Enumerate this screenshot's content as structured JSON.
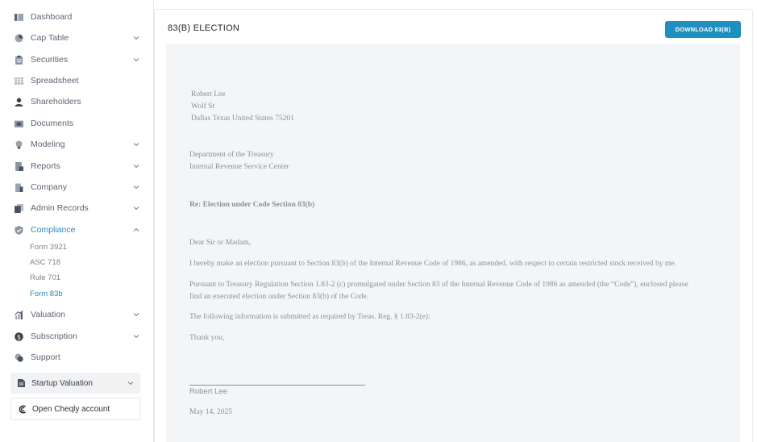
{
  "sidebar": {
    "items": [
      {
        "label": "Dashboard"
      },
      {
        "label": "Cap Table"
      },
      {
        "label": "Securities"
      },
      {
        "label": "Spreadsheet"
      },
      {
        "label": "Shareholders"
      },
      {
        "label": "Documents"
      },
      {
        "label": "Modeling"
      },
      {
        "label": "Reports"
      },
      {
        "label": "Company"
      },
      {
        "label": "Admin Records"
      },
      {
        "label": "Compliance"
      },
      {
        "label": "Valuation"
      },
      {
        "label": "Subscription"
      },
      {
        "label": "Support"
      }
    ],
    "compliance_sub": [
      {
        "label": "Form 3921"
      },
      {
        "label": "ASC 718"
      },
      {
        "label": "Rule 701"
      },
      {
        "label": "Form 83b"
      }
    ],
    "startup_valuation": "Startup Valuation",
    "cheqly": "Open Cheqly account"
  },
  "page": {
    "title": "83(B) ELECTION",
    "download_label": "DOWNLOAD 83(B)"
  },
  "document": {
    "name": "Robert Lee",
    "street": "Wolf St",
    "city_line": "Dallas Texas United States 75201",
    "dept": "Department of the Treasury",
    "irs": "Internal Revenue Service Center",
    "re": "Re: Election under Code Section 83(b)",
    "salutation": "Dear Sir or Madam,",
    "p1": "I hereby make an election pursuant to Section 83(b) of the Internal Revenue Code of 1986, as amended, with respect to certain restricted stock received by me.",
    "p2a": "Pursuant to Treasury Regulation Section 1.83-2 (c) promulgated under Section 83 of the Internal Revenue Code of 1986 as amended (the “Code”), enclosed please",
    "p2b": "find an executed election under Section 83(b) of the Code.",
    "p3": "The following information is submitted as required by Treas. Reg. § 1.83-2(e):",
    "thanks": "Thank you,",
    "signature_name": "Robert Lee",
    "date": "May 14, 2025"
  },
  "colors": {
    "accent": "#2e86b8",
    "button": "#1f8fc0",
    "doc_bg": "#f4f5f7"
  }
}
